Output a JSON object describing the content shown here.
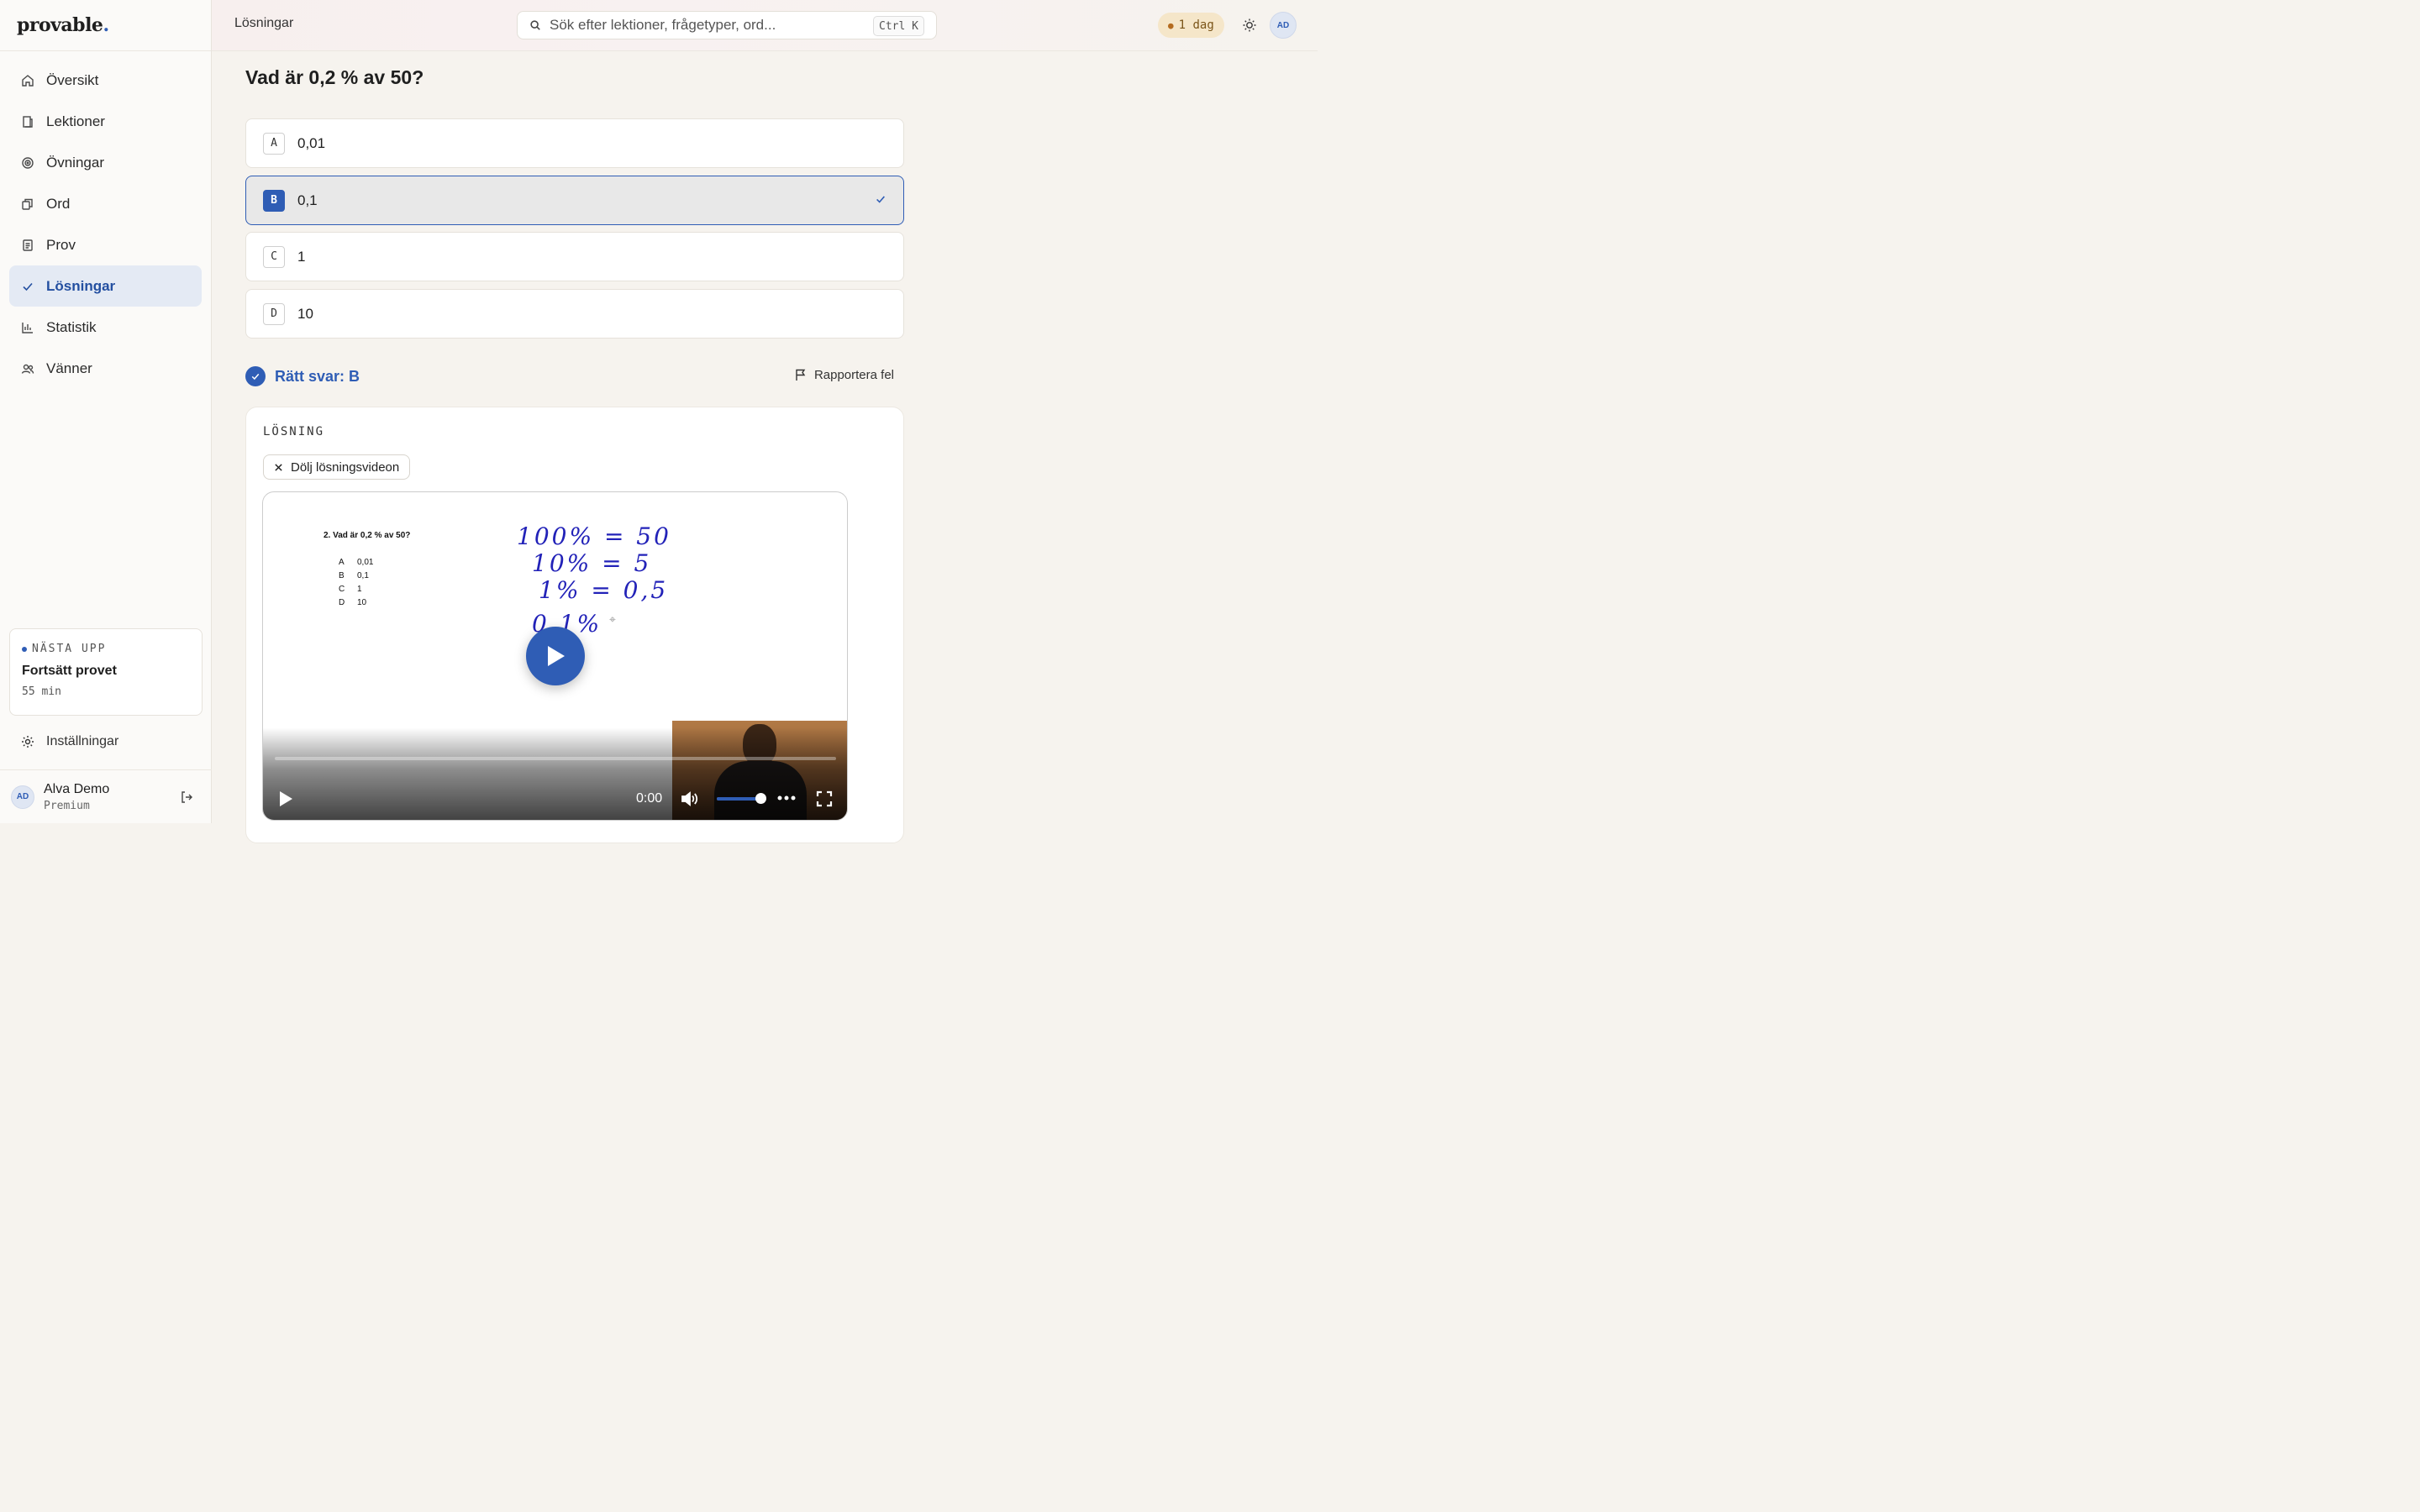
{
  "brand": {
    "name": "provable",
    "dot": "."
  },
  "sidebar": {
    "items": [
      {
        "label": "Översikt",
        "icon": "home-icon"
      },
      {
        "label": "Lektioner",
        "icon": "book-icon"
      },
      {
        "label": "Övningar",
        "icon": "target-icon"
      },
      {
        "label": "Ord",
        "icon": "cards-icon"
      },
      {
        "label": "Prov",
        "icon": "document-icon"
      },
      {
        "label": "Lösningar",
        "icon": "check-icon",
        "active": true
      },
      {
        "label": "Statistik",
        "icon": "bar-chart-icon"
      },
      {
        "label": "Vänner",
        "icon": "users-icon"
      }
    ],
    "next_up": {
      "tag": "NÄSTA UPP",
      "title": "Fortsätt provet",
      "time": "55 min"
    },
    "settings_label": "Inställningar",
    "user": {
      "initials": "AD",
      "name": "Alva Demo",
      "plan": "Premium"
    }
  },
  "topbar": {
    "breadcrumb": "Lösningar",
    "search_placeholder": "Sök efter lektioner, frågetyper, ord...",
    "search_shortcut": "Ctrl K",
    "streak": "1 dag",
    "avatar_initials": "AD"
  },
  "main": {
    "question": "Vad är 0,2 % av 50?",
    "options": [
      {
        "letter": "A",
        "text": "0,01"
      },
      {
        "letter": "B",
        "text": "0,1",
        "selected": true
      },
      {
        "letter": "C",
        "text": "1"
      },
      {
        "letter": "D",
        "text": "10"
      }
    ],
    "correct_answer": "Rätt svar: B",
    "report_label": "Rapportera fel",
    "solution": {
      "label": "LÖSNING",
      "hide_video_label": "Dölj lösningsvideon",
      "video": {
        "slide_question": "2.  Vad är 0,2 % av 50?",
        "slide_options": [
          {
            "letter": "A",
            "text": "0,01"
          },
          {
            "letter": "B",
            "text": "0,1"
          },
          {
            "letter": "C",
            "text": "1"
          },
          {
            "letter": "D",
            "text": "10"
          }
        ],
        "handwriting": [
          "100% = 50",
          "10% = 5",
          "1% = 0,5",
          "0,1%"
        ],
        "time": "0:00",
        "progress": 0,
        "volume": 0.9
      }
    }
  },
  "colors": {
    "accent": "#2f5db5",
    "background": "#f6f3ee",
    "streak_bg": "#f5e6c9"
  }
}
